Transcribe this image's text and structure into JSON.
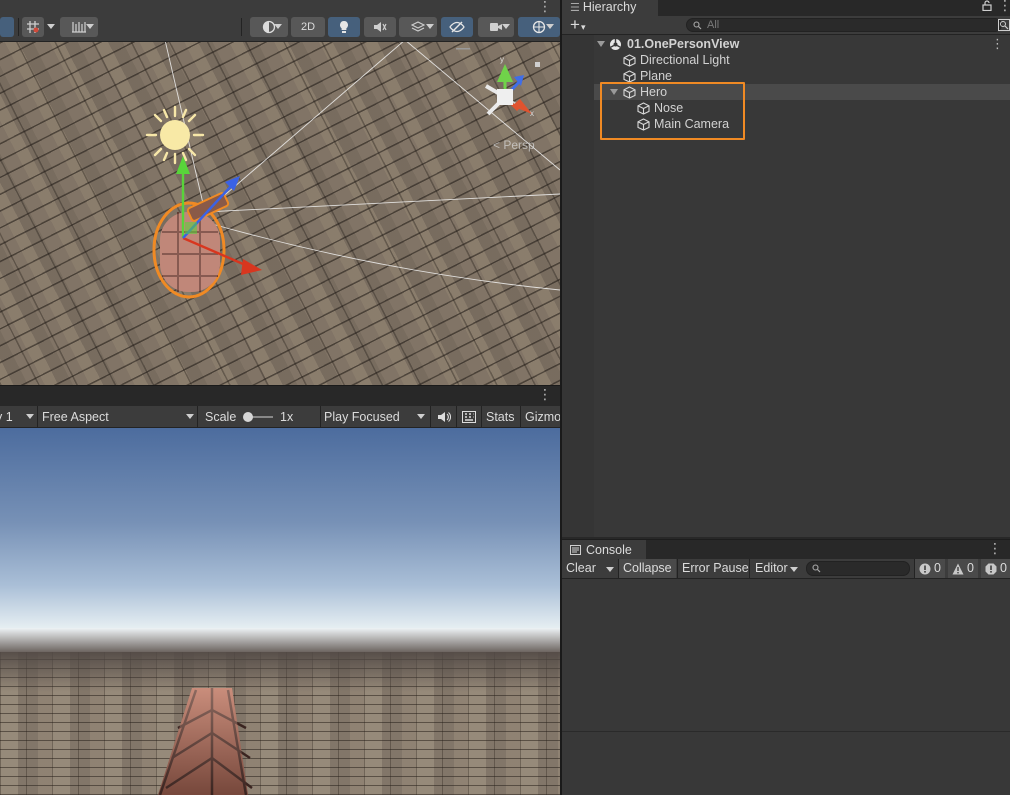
{
  "scene": {
    "toolbar": {
      "two_d_label": "2D",
      "menu_icon": "kebab-icon"
    },
    "view_label": "< Persp",
    "gizmo_axes": {
      "y": "y",
      "x": "x"
    }
  },
  "game": {
    "toolbar": {
      "display_label": "y 1",
      "aspect_label": "Free Aspect",
      "scale_label": "Scale",
      "scale_value": "1x",
      "play_mode_label": "Play Focused",
      "stats_label": "Stats",
      "gizmos_label": "Gizmo"
    }
  },
  "hierarchy": {
    "tab_label": "Hierarchy",
    "search_placeholder": "All",
    "scene_name": "01.OnePersonView",
    "items": [
      {
        "label": "Directional Light",
        "depth": 1
      },
      {
        "label": "Plane",
        "depth": 1
      },
      {
        "label": "Hero",
        "depth": 1,
        "expanded": true,
        "selected": true
      },
      {
        "label": "Nose",
        "depth": 2
      },
      {
        "label": "Main Camera",
        "depth": 2
      }
    ]
  },
  "console": {
    "tab_label": "Console",
    "clear_label": "Clear",
    "collapse_label": "Collapse",
    "error_pause_label": "Error Pause",
    "editor_label": "Editor",
    "counts": {
      "info": "0",
      "warnings": "0",
      "errors": "0"
    }
  },
  "colors": {
    "selection_outline": "#f08a24",
    "active_tool": "#46607c",
    "panel": "#383838",
    "toolbar": "#3c3c3c"
  }
}
